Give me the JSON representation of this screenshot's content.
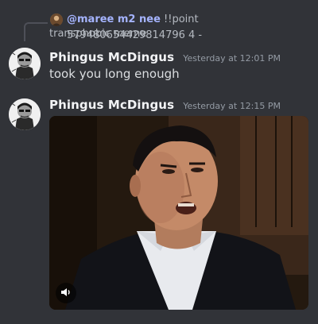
{
  "reply": {
    "author": "@maree m2 nee",
    "text_line1": "!!point 579480654429814796 4 -",
    "text_line2": "transphobic meme"
  },
  "messages": [
    {
      "author": "Phingus McDingus",
      "timestamp": "Yesterday at 12:01 PM",
      "content": "took you long enough"
    },
    {
      "author": "Phingus McDingus",
      "timestamp": "Yesterday at 12:15 PM",
      "attachment": {
        "type": "video",
        "control_icon": "volume-icon"
      }
    }
  ],
  "colors": {
    "background": "#313338",
    "author": "#f2f3f5",
    "timestamp": "#949ba4",
    "mention": "#a5b4ff"
  }
}
